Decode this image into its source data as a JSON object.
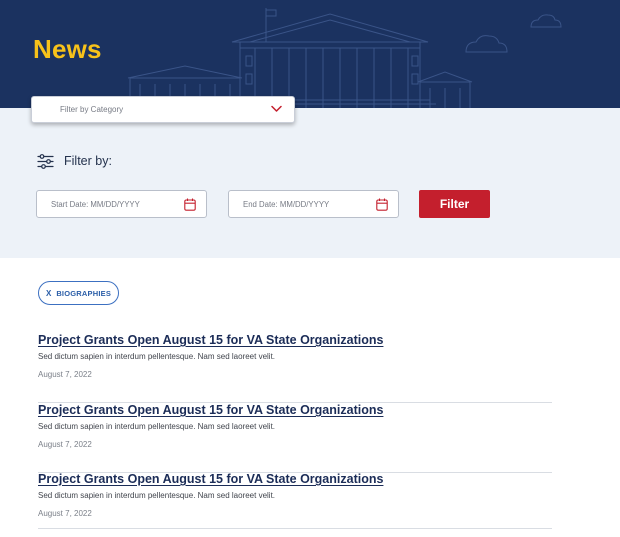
{
  "hero": {
    "title": "News"
  },
  "category_filter": {
    "label": "Filter by Category"
  },
  "filters": {
    "heading": "Filter by:",
    "start_date_placeholder": "Start Date: MM/DD/YYYY",
    "end_date_placeholder": "End Date: MM/DD/YYYY",
    "button_label": "Filter"
  },
  "active_tag": {
    "remove_label": "X",
    "label": "BIOGRAPHIES"
  },
  "articles": [
    {
      "title": "Project Grants Open August 15 for VA State Organizations",
      "excerpt": "Sed dictum sapien in interdum pellentesque. Nam sed laoreet velit.",
      "date": "August 7, 2022"
    },
    {
      "title": "Project Grants Open August 15 for VA State Organizations",
      "excerpt": "Sed dictum sapien in interdum pellentesque. Nam sed laoreet velit.",
      "date": "August 7, 2022"
    },
    {
      "title": "Project Grants Open August 15 for VA State Organizations",
      "excerpt": "Sed dictum sapien in interdum pellentesque. Nam sed laoreet velit.",
      "date": "August 7, 2022"
    }
  ],
  "colors": {
    "hero_background": "#1b3260",
    "hero_title": "#f7c21a",
    "filter_band": "#edf2f8",
    "filter_button": "#c41f2d",
    "tag_border": "#3c70c1",
    "article_title": "#1b2c57"
  },
  "icons": {
    "category_dropdown": "chevron-down-icon",
    "filter_heading": "sliders-icon",
    "date_picker": "calendar-icon"
  }
}
